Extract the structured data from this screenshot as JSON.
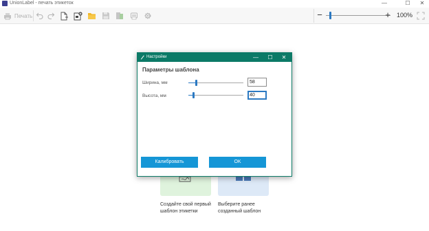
{
  "window": {
    "title": "UnionLabel - печать этикеток",
    "controls": {
      "minimize": "—",
      "maximize": "☐",
      "close": "✕"
    }
  },
  "toolbar": {
    "print_label": "Печать",
    "icons": [
      "printer-icon",
      "undo-icon",
      "redo-icon",
      "new-file-icon",
      "new-template-icon",
      "open-folder-icon",
      "save-icon",
      "export-icon",
      "print-preview-icon",
      "settings-icon"
    ]
  },
  "zoom": {
    "minus": "−",
    "plus": "+",
    "value": "100%",
    "level_fraction": 0.06
  },
  "start_cards": [
    {
      "text_line1": "Создайте свой первый",
      "text_line2": "шаблон этикетки"
    },
    {
      "text_line1": "Выберите ранее",
      "text_line2": "созданный шаблон"
    }
  ],
  "dialog": {
    "title": "Настройки",
    "controls": {
      "minimize": "—",
      "maximize": "☐",
      "close": "✕"
    },
    "section_title": "Параметры шаблона",
    "width": {
      "label": "Ширина, мм",
      "value": "58",
      "slider_fraction": 0.14
    },
    "height": {
      "label": "Высота, мм",
      "value": "40",
      "slider_fraction": 0.09
    },
    "calibrate_label": "Калибровать",
    "ok_label": "OK"
  },
  "colors": {
    "dialog_accent": "#0c7a67",
    "button_blue": "#1596d6",
    "slider_blue": "#2b79c2",
    "app_icon": "#3a3d8f"
  }
}
